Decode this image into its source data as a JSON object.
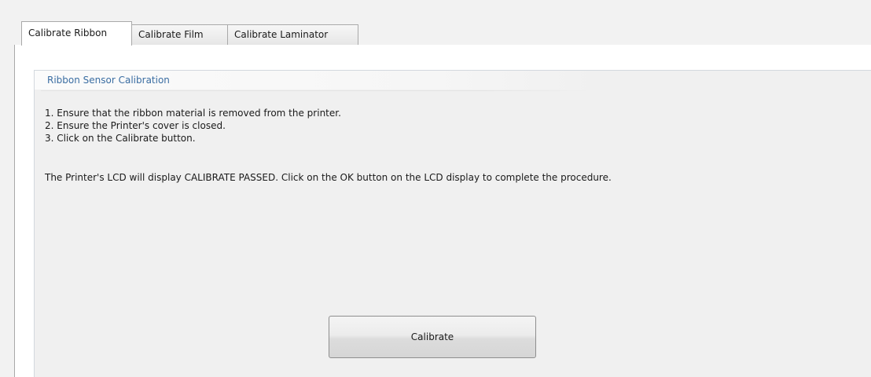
{
  "tabs": [
    {
      "label": "Calibrate Ribbon",
      "active": true
    },
    {
      "label": "Calibrate Film",
      "active": false
    },
    {
      "label": "Calibrate Laminator",
      "active": false
    }
  ],
  "group": {
    "title": "Ribbon Sensor Calibration",
    "steps": [
      "1. Ensure that the ribbon material is removed from the printer.",
      "2. Ensure the Printer's cover is closed.",
      "3. Click on the Calibrate button."
    ],
    "note": "The Printer's LCD will display CALIBRATE PASSED.  Click on the OK button on the LCD display to complete the procedure."
  },
  "buttons": {
    "calibrate_label": "Calibrate"
  },
  "colors": {
    "group_title": "#3a6da2",
    "panel_background": "#f0f0f0",
    "window_background": "#f2f2f2"
  }
}
